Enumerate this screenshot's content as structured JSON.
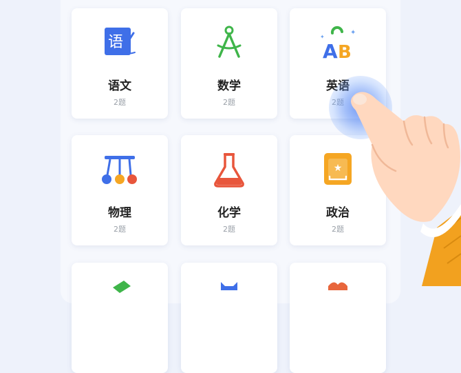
{
  "subjects": [
    {
      "name": "语文",
      "count": "2题",
      "icon": "chinese-book-icon"
    },
    {
      "name": "数学",
      "count": "2题",
      "icon": "compass-icon"
    },
    {
      "name": "英语",
      "count": "2题",
      "icon": "abc-letters-icon"
    },
    {
      "name": "物理",
      "count": "2题",
      "icon": "newtons-cradle-icon"
    },
    {
      "name": "化学",
      "count": "2题",
      "icon": "flask-icon"
    },
    {
      "name": "政治",
      "count": "2题",
      "icon": "book-star-icon"
    }
  ],
  "partial_row_icons": [
    "green-book-icon",
    "blue-icon",
    "orange-icon"
  ],
  "colors": {
    "accent_blue": "#3f6fe8",
    "green": "#3fb54a",
    "orange": "#f5a623",
    "red": "#e8563c",
    "title": "#222222",
    "subtext": "#9aa0a8"
  }
}
